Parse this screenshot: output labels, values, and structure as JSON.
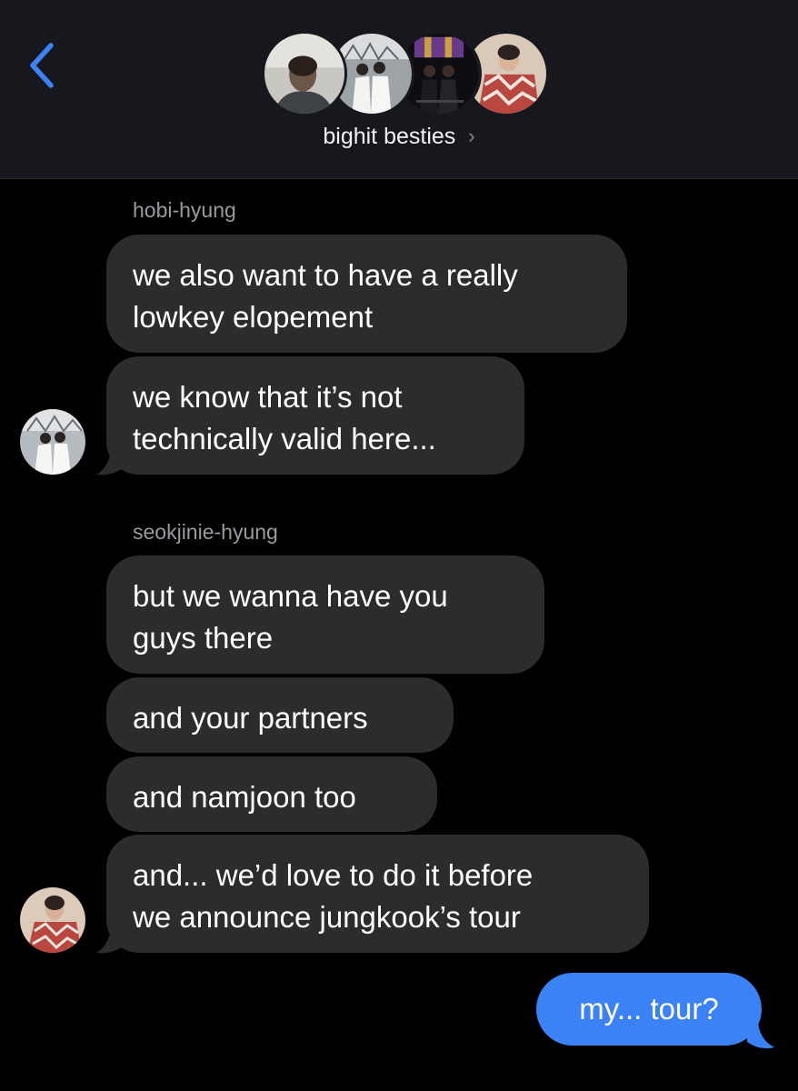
{
  "header": {
    "group_name": "bighit besties",
    "chevron": "›",
    "back_icon": "chevron-left-icon",
    "accent_color": "#3b82f6"
  },
  "messages": {
    "sender_1": "hobi-hyung",
    "m1": [
      "we also want to have a really",
      "lowkey elopement"
    ],
    "m2": [
      "we know that it’s not",
      "technically valid here..."
    ],
    "sender_2": "seokjinie-hyung",
    "m3": [
      "but we wanna have you",
      "guys there"
    ],
    "m4": "and your partners",
    "m5": "and namjoon too",
    "m6": [
      "and... we’d love to do it before",
      "we announce jungkook’s tour"
    ],
    "outgoing": "my... tour?"
  },
  "colors": {
    "incoming_bubble": "#2c2c2e",
    "outgoing_bubble": "#3b82f6",
    "header_bg": "#17181d"
  }
}
